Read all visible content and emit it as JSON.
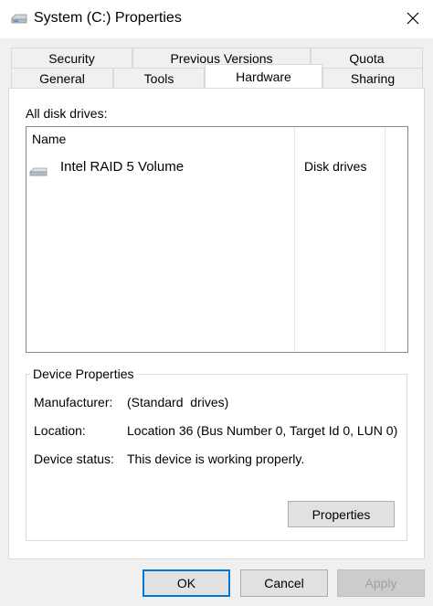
{
  "window": {
    "title": "System (C:) Properties",
    "title_icon": "drive-icon",
    "close_icon": "close-icon"
  },
  "tabs": {
    "row1": [
      "Security",
      "Previous Versions",
      "Quota"
    ],
    "row2": [
      "General",
      "Tools",
      "Hardware",
      "Sharing"
    ],
    "selected": "Hardware"
  },
  "disks": {
    "label": "All disk drives:",
    "column_name": "Name",
    "rows": [
      {
        "name": "Intel RAID 5 Volume",
        "type": "Disk drives",
        "icon": "disk-drive-icon"
      }
    ]
  },
  "device_properties": {
    "title": "Device Properties",
    "manufacturer_label": "Manufacturer:",
    "manufacturer_value": "(Standard  drives)",
    "location_label": "Location:",
    "location_value": "Location 36 (Bus Number 0, Target Id 0, LUN 0)",
    "status_label": "Device status:",
    "status_value": "This device is working properly.",
    "properties_button": "Properties"
  },
  "buttons": {
    "ok": "OK",
    "cancel": "Cancel",
    "apply": "Apply"
  },
  "colors": {
    "accent": "#0078d7",
    "panel_bg": "#ffffff",
    "window_bg": "#f0f0f0"
  }
}
